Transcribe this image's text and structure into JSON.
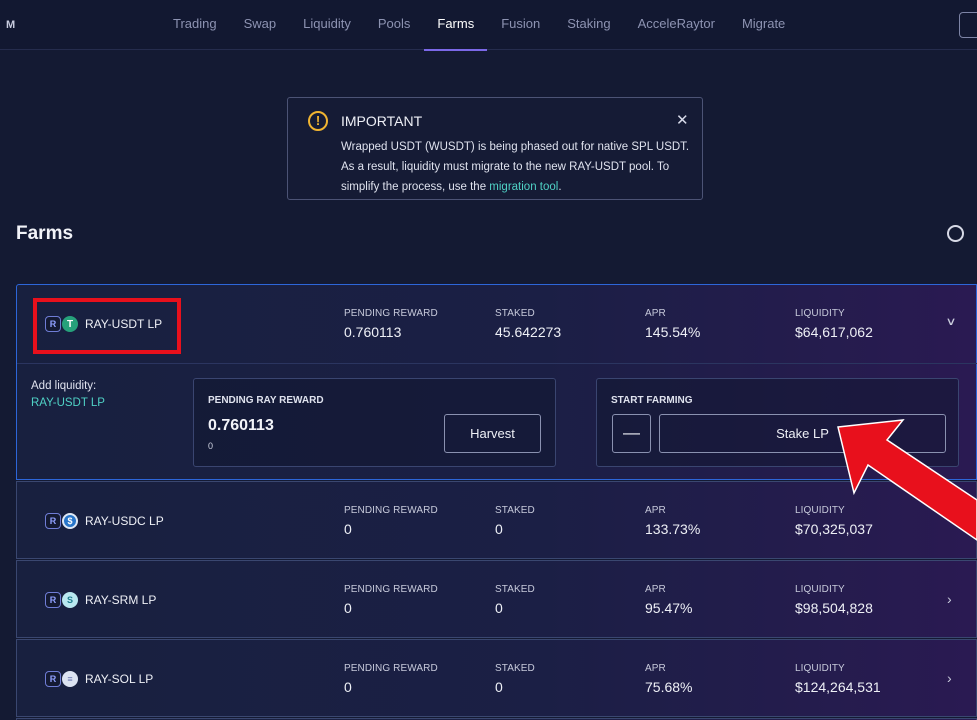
{
  "nav": {
    "logo": "M",
    "tabs": [
      "Trading",
      "Swap",
      "Liquidity",
      "Pools",
      "Farms",
      "Fusion",
      "Staking",
      "AcceleRaytor",
      "Migrate"
    ],
    "active_tab": "Farms"
  },
  "notice": {
    "title": "IMPORTANT",
    "body": "Wrapped USDT (WUSDT) is being phased out for native SPL USDT. As a result, liquidity must migrate to the new RAY-USDT pool. To simplify the process, use the ",
    "link": "migration tool",
    "end": ".",
    "close": "✕",
    "icon": "warning-icon"
  },
  "page": {
    "title": "Farms"
  },
  "labels": {
    "pending_reward": "PENDING REWARD",
    "staked": "STAKED",
    "apr": "APR",
    "liquidity": "LIQUIDITY"
  },
  "farms": [
    {
      "pair": "RAY-USDT LP",
      "token_b": "T",
      "pending": "0.760113",
      "staked": "45.642273",
      "apr": "145.54%",
      "liquidity": "$64,617,062"
    },
    {
      "pair": "RAY-USDC LP",
      "token_b": "$",
      "pending": "0",
      "staked": "0",
      "apr": "133.73%",
      "liquidity": "$70,325,037"
    },
    {
      "pair": "RAY-SRM LP",
      "token_b": "S",
      "pending": "0",
      "staked": "0",
      "apr": "95.47%",
      "liquidity": "$98,504,828"
    },
    {
      "pair": "RAY-SOL LP",
      "token_b": "≡",
      "pending": "0",
      "staked": "0",
      "apr": "75.68%",
      "liquidity": "$124,264,531"
    }
  ],
  "expanded": {
    "add_liquidity_label": "Add liquidity:",
    "add_liquidity_link": "RAY-USDT LP",
    "reward_label": "PENDING RAY REWARD",
    "reward_value": "0.760113",
    "reward_sub": "0",
    "harvest": "Harvest",
    "start_farming": "START FARMING",
    "minus": "—",
    "stake": "Stake LP"
  },
  "colors": {
    "background": "#141a33",
    "accent_teal": "#4fd1c5",
    "active_tab_underline": "#7b68e8",
    "warning": "#f0b431",
    "annotation_red": "#e8101c"
  }
}
